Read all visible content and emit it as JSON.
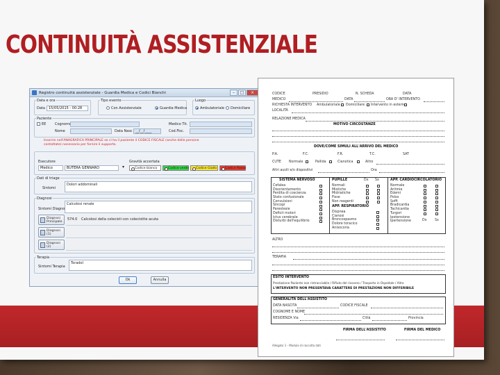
{
  "slide": {
    "title": "CONTINUITÀ ASSISTENZIALE"
  },
  "app": {
    "window_title": "Registro continuità assistenziale - Guardia Medica e Codici Bianchi",
    "data_ora": {
      "group_label": "Data e ora",
      "data_label": "Data",
      "value": "15/05/2015 - 00:28"
    },
    "tipo_evento": {
      "label": "Tipo evento",
      "options": [
        "Con Assistenziale",
        "Guardia Medica"
      ],
      "selected": "Guardia Medica"
    },
    "luogo": {
      "label": "Luogo",
      "options": [
        "Ambulatoriale",
        "Domiciliare"
      ],
      "selected": "Ambulatoriale"
    },
    "paziente": {
      "label": "Paziente",
      "ee_label": "EE",
      "cognome_label": "Cognome",
      "nome_label": "Nome",
      "data_nasc_label": "Data Nasc",
      "data_nasc_value": "__/__/____",
      "medico_label": "Medico Tit.",
      "codfisc_label": "Cod.Fisc."
    },
    "warning": "Inserire nell'ANAGRAFICA PRINCIPALE se ci ha il paziente il CODICE FISCALE (anche delle persone contattate) necessario per fornire il supporto.",
    "esecutore": {
      "label": "Esecutore",
      "role_value": "Medico",
      "name_value": "BUTERA GENNARO"
    },
    "gravita": {
      "label": "Gravità accertata",
      "options": [
        "Codice bianco",
        "Codice verde",
        "Codice Giallo",
        "Codice Rosso"
      ],
      "selected": "Codice bianco",
      "colors": {
        "bianco": "#ffffff",
        "verde": "#39d04a",
        "giallo": "#f5e33a",
        "rosso": "#e33b2e"
      }
    },
    "dati_anamnesi": {
      "label": "Dati di triage",
      "sintomi_label": "Sintomi",
      "sintomi_value": "Dolori addominali"
    },
    "diagnosi": {
      "label": "Diagnosi",
      "sintomi_label": "Sintomi Diagnosi",
      "sintomi_value": "Calcolosi renale",
      "rows": [
        {
          "button": "Diagnosi Principale",
          "code": "574.0",
          "desc": "Calcolosi della colecisti con colecistite acuta"
        },
        {
          "button": "Diagnosi (1)",
          "code": "",
          "desc": ""
        },
        {
          "button": "Diagnosi (2)",
          "code": "",
          "desc": ""
        }
      ]
    },
    "terapia": {
      "label": "Terapia",
      "sintomi_label": "Sintomi Terapia",
      "value": "Toradol"
    },
    "buttons": {
      "ok": "Ok",
      "annulla": "Annulla"
    }
  },
  "form": {
    "header_fields": [
      "CODICE",
      "PRESIDIO",
      "N. SCHEDA",
      "DATA"
    ],
    "medico_label": "MEDICO",
    "data_label": "DATA",
    "ora_intervento_label": "ORA D' INTERVENTO",
    "richiesta_label": "RICHIESTA INTERVENTO",
    "richiesta_opts": [
      "Ambulatoriale",
      "Domiciliare",
      "Intervento in esterno"
    ],
    "localita_label": "LOCALITÀ",
    "relazione_label": "RELAZIONE MEDICA",
    "motivo_label": "MOTIVO CIRCOSTANZE",
    "parametri_title": "DOVE/COME SIMULI ALL'ARRIVO DEL MEDICO",
    "parametri_fields": [
      "P.A.",
      "F.C.",
      "F.R.",
      "T.C.",
      "SAT"
    ],
    "cute_label": "CUTE",
    "cute_opts": [
      "Normale",
      "Pallida",
      "Cianotica",
      "Altro"
    ],
    "ora_label": "Ora",
    "ausili_label": "Altri ausili e/o dispositivi",
    "sections": {
      "nervoso": {
        "title": "SISTEMA NERVOSO",
        "items": [
          "Cefalea",
          "Disorientamento",
          "Perdita di coscienza",
          "Stato confusionale",
          "Convulsioni",
          "Sincopi",
          "Parestesie",
          "Deficit motori",
          "Ictus cerebrale",
          "Disturbi dell'equilibrio"
        ]
      },
      "pupille": {
        "title": "PUPILLE",
        "cols": [
          "Dx",
          "Sx"
        ],
        "items": [
          "Normali",
          "Miotiche",
          "Midriatiche",
          "Fisse",
          "Non reagenti",
          "Anisocoria"
        ]
      },
      "respiratorio": {
        "title": "APP. RESPIRATORIO",
        "items": [
          "Dispnea",
          "Cianosi",
          "Broncospasmo",
          "Dolore toracico"
        ]
      },
      "cardio": {
        "title": "APP. CARDIOCIRCOLATORIO",
        "cols": [
          "Dx",
          "Sx"
        ],
        "items": [
          "Normale",
          "Aritmie",
          "Edemi",
          "Polso",
          "Soffi",
          "Bradicardia",
          "Tachicardia",
          "Turgori",
          "Ipotensione",
          "Ipertensione"
        ]
      }
    },
    "altro_label": "ALTRO",
    "terapia_label": "TERAPIA",
    "esito_title": "ESITO INTERVENTO",
    "esito_line": "Prestazione Paziente non rintracciabile / Rifiuto del ricovero / Trasporto in Ospedale / Altro",
    "esito_bold_line": "L'INTERVENTO NON PRESENTAVA CARATTERE DI PRESTAZIONE NON DIFFERIBILE",
    "generalita_title": "GENERALITÀ DELL'ASSISTITO",
    "generalita_fields": [
      "DATA NASCITA",
      "CODICE FISCALE",
      "COGNOME E NOME",
      "RESIDENZA Via",
      "Città",
      "Provincia"
    ],
    "firma_assistito": "FIRMA DELL'ASSISTITO",
    "firma_medico": "FIRMA DEL MEDICO",
    "footer": "Allegato 1 - Modulo di raccolta dati"
  }
}
